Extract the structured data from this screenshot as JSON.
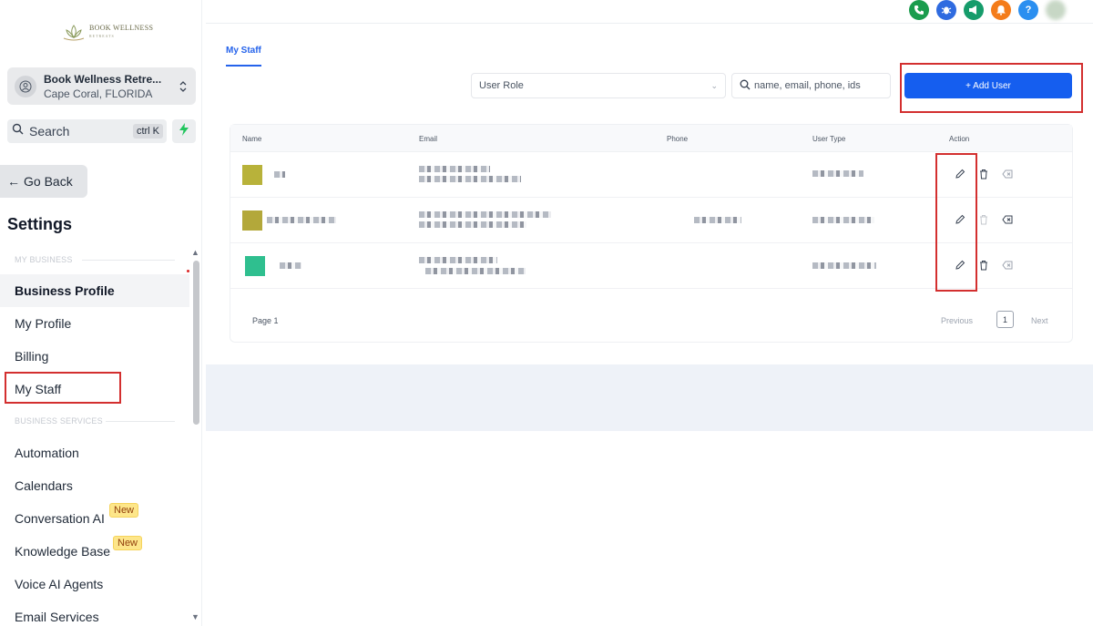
{
  "brand": {
    "line1": "BOOK WELLNESS",
    "line2": "RETREATS"
  },
  "location": {
    "name": "Book Wellness Retre...",
    "city": "Cape Coral, FLORIDA"
  },
  "search": {
    "label": "Search",
    "shortcut": "ctrl K"
  },
  "go_back": "Go Back",
  "settings_title": "Settings",
  "nav": {
    "section_business": "MY BUSINESS",
    "section_services": "BUSINESS SERVICES",
    "items": [
      {
        "label": "Business Profile"
      },
      {
        "label": "My Profile"
      },
      {
        "label": "Billing"
      },
      {
        "label": "My Staff"
      },
      {
        "label": "Automation"
      },
      {
        "label": "Calendars"
      },
      {
        "label": "Conversation AI",
        "badge": "New"
      },
      {
        "label": "Knowledge Base",
        "badge": "New"
      },
      {
        "label": "Voice AI Agents"
      },
      {
        "label": "Email Services"
      }
    ]
  },
  "top_icons": [
    {
      "name": "phone-icon",
      "color": "#1a9c4d"
    },
    {
      "name": "bug-icon",
      "color": "#2f6be0"
    },
    {
      "name": "megaphone-icon",
      "color": "#169c6b"
    },
    {
      "name": "bell-icon",
      "color": "#f47c1a"
    },
    {
      "name": "help-icon",
      "color": "#2b8ff0"
    }
  ],
  "main": {
    "tab": "My Staff",
    "role_placeholder": "User Role",
    "search_placeholder": "name, email, phone, ids",
    "add_user": "+ Add User"
  },
  "table": {
    "headers": {
      "name": "Name",
      "email": "Email",
      "phone": "Phone",
      "user_type": "User Type",
      "action": "Action"
    },
    "row_avatars": [
      "#b8b23a",
      "#b3a83a",
      "#2fbf8f"
    ]
  },
  "pager": {
    "page_label": "Page 1",
    "previous": "Previous",
    "current": "1",
    "next": "Next"
  }
}
